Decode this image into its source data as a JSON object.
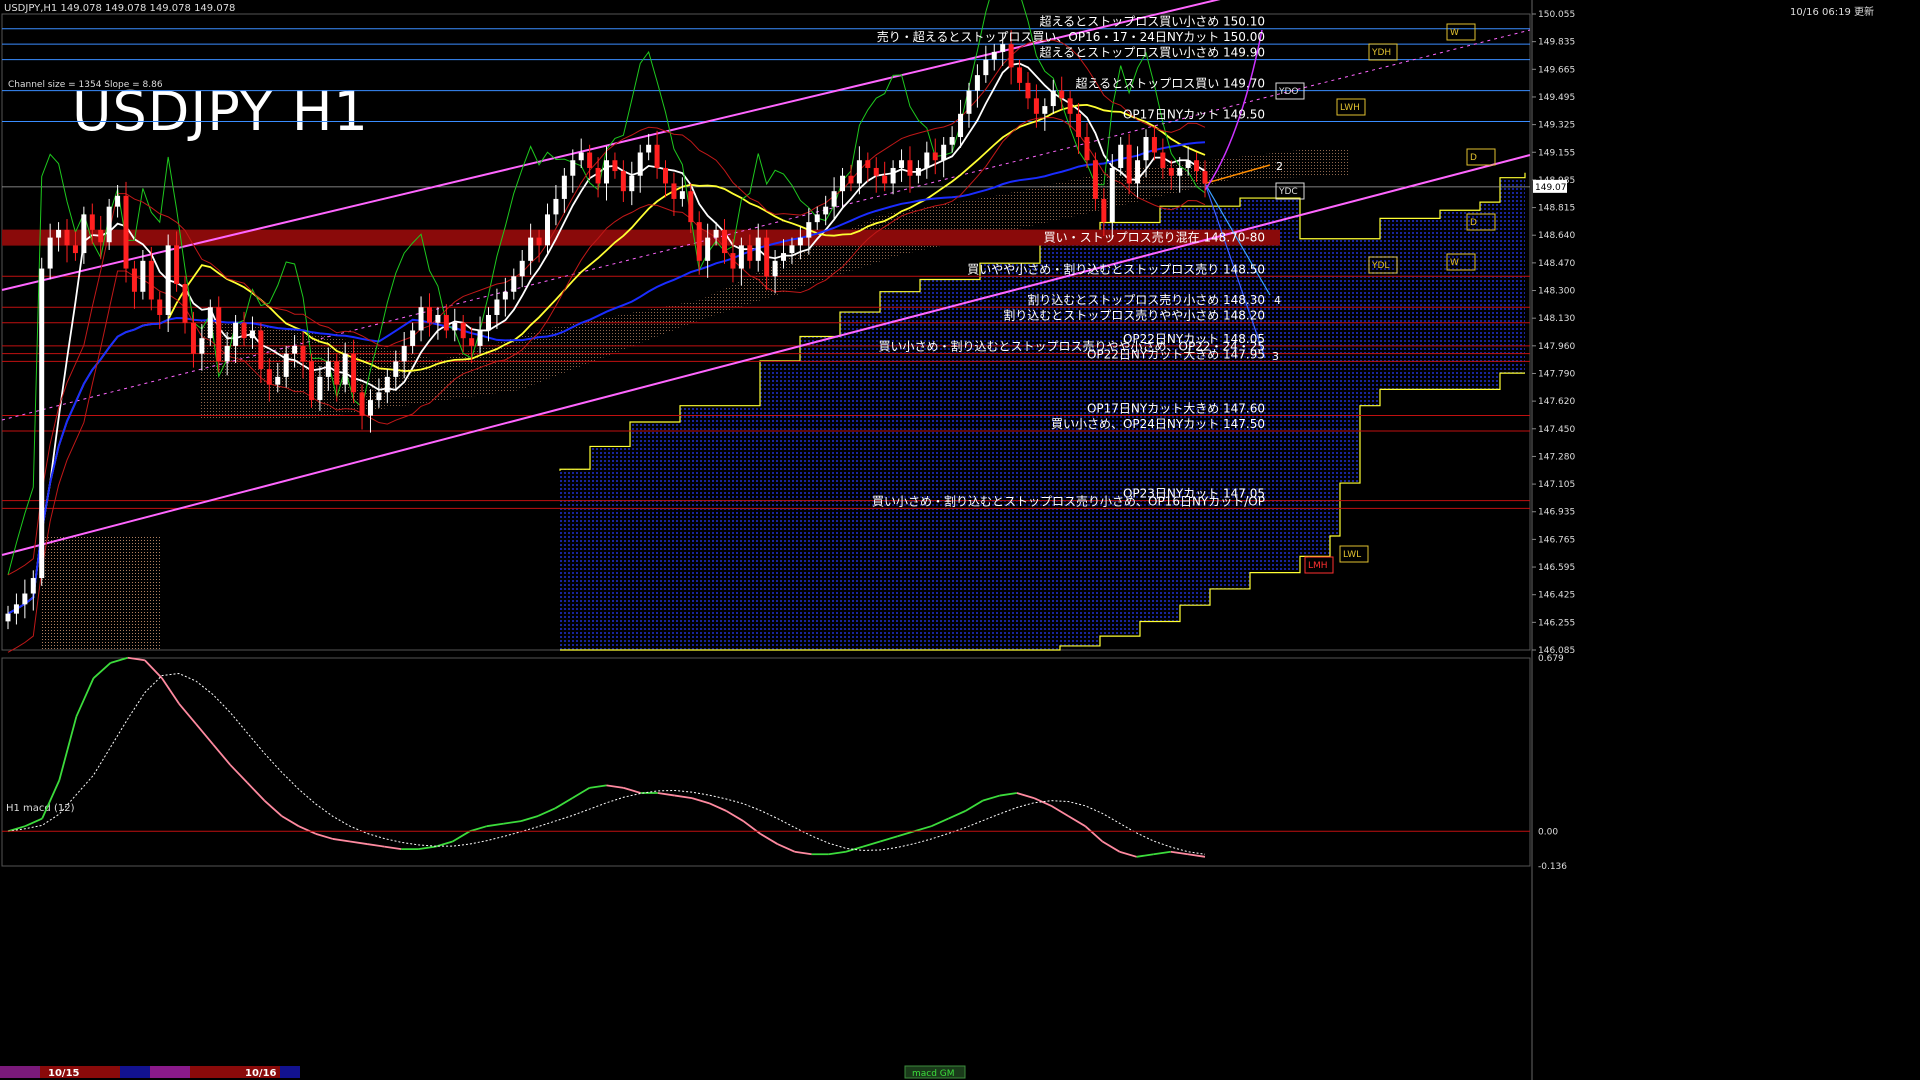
{
  "header": {
    "symbol_line": "USDJPY,H1  149.078 149.078 149.078 149.078",
    "title": "USDJPY H1",
    "channel_info": "Channel size = 1354  Slope = 8.86",
    "clock": "10/16 06:19 更新",
    "macd_label": "H1 macd (12)",
    "macd_mini_label": "macd GM"
  },
  "colors": {
    "background": "#000000",
    "up_candle": "#ffffff",
    "down_candle": "#ff2020",
    "channel": "#ff66ff",
    "ma_short": "#ffffff",
    "ma_mid": "#ffff33",
    "ma_long": "#1a2cff",
    "kumo_boundary": "#ffff33",
    "kumo_fill": "#101a66",
    "green_line": "#1ec81e",
    "macd_up": "#3cdc3c",
    "macd_down": "#ff8aa0",
    "hline_red": "#c01010",
    "hline_blue": "#3a8dff"
  },
  "chart_data": [
    {
      "type": "line",
      "title": "USDJPY H1",
      "ylim": [
        146.085,
        150.195
      ],
      "y_ticks": [
        "150.055",
        "149.835",
        "149.665",
        "149.495",
        "149.325",
        "149.155",
        "148.985",
        "148.815",
        "148.640",
        "148.470",
        "148.300",
        "148.130",
        "147.960",
        "147.790",
        "147.620",
        "147.450",
        "147.280",
        "147.105",
        "146.935",
        "146.765",
        "146.595",
        "146.425",
        "146.255",
        "146.085"
      ],
      "current_price": "149.078",
      "x_labels": [
        "10/15",
        "10/16"
      ],
      "annotations": [
        {
          "price": 150.1,
          "text": "超えるとストップロス買い小さめ 150.10",
          "color": "blue"
        },
        {
          "price": 150.0,
          "text": "売り・超えるとストップロス買い、OP16・17・24日NYカット 150.00",
          "color": "blue"
        },
        {
          "price": 149.9,
          "text": "超えるとストップロス買い小さめ 149.90",
          "color": "blue"
        },
        {
          "price": 149.7,
          "text": "超えるとストップロス買い 149.70",
          "color": "blue"
        },
        {
          "price": 149.5,
          "text": "OP17日NYカット 149.50",
          "color": "blue"
        },
        {
          "price": 148.75,
          "text": "買い・ストップロス売り混在 148.70-80",
          "color": "red-band"
        },
        {
          "price": 148.5,
          "text": "買いやや小さめ・割り込むとストップロス売り 148.50",
          "color": "red"
        },
        {
          "price": 148.3,
          "text": "割り込むとストップロス売り小さめ 148.30",
          "color": "red"
        },
        {
          "price": 148.2,
          "text": "割り込むとストップロス売りやや小さめ 148.20",
          "color": "red"
        },
        {
          "price": 148.05,
          "text": "OP22日NYカット 148.05",
          "color": "red"
        },
        {
          "price": 148.0,
          "text": "買い小さめ・割り込むとストップロス売りやや小さめ、OP22・24・25",
          "color": "red"
        },
        {
          "price": 147.95,
          "text": "OP22日NYカット大きめ 147.95",
          "color": "red"
        },
        {
          "price": 147.6,
          "text": "OP17日NYカット大きめ 147.60",
          "color": "red"
        },
        {
          "price": 147.5,
          "text": "買い小さめ、OP24日NYカット 147.50",
          "color": "red"
        },
        {
          "price": 147.05,
          "text": "OP23日NYカット 147.05",
          "color": "red"
        },
        {
          "price": 147.0,
          "text": "買い小さめ・割り込むとストップロス売り小さめ、OP16日NYカット/OP",
          "color": "red"
        }
      ],
      "box_labels": [
        "YDH",
        "YDO",
        "YDC",
        "YDL",
        "LWH",
        "LMH",
        "LWL",
        "D",
        "D",
        "W",
        "W"
      ],
      "wave_labels": [
        "2",
        "4",
        "3"
      ],
      "series_close": [
        146.32,
        146.38,
        146.45,
        146.55,
        148.55,
        148.75,
        148.8,
        148.7,
        148.65,
        148.9,
        148.8,
        148.72,
        148.95,
        149.02,
        148.55,
        148.4,
        148.6,
        148.35,
        148.25,
        148.7,
        148.45,
        148.2,
        148.0,
        148.1,
        148.3,
        147.95,
        148.05,
        148.2,
        148.1,
        148.15,
        147.9,
        147.8,
        147.85,
        148.0,
        148.05,
        147.95,
        147.7,
        147.85,
        147.95,
        147.8,
        148.0,
        147.75,
        147.6,
        147.7,
        147.75,
        147.85,
        147.95,
        148.05,
        148.15,
        148.3,
        148.2,
        148.25,
        148.15,
        148.2,
        148.1,
        148.05,
        148.15,
        148.25,
        148.35,
        148.4,
        148.5,
        148.6,
        148.75,
        148.7,
        148.9,
        149.0,
        149.15,
        149.25,
        149.3,
        149.2,
        149.1,
        149.25,
        149.18,
        149.05,
        149.15,
        149.3,
        149.35,
        149.2,
        149.1,
        149.0,
        149.05,
        148.85,
        148.6,
        148.75,
        148.8,
        148.65,
        148.55,
        148.7,
        148.6,
        148.75,
        148.5,
        148.6,
        148.65,
        148.7,
        148.75,
        148.85,
        148.9,
        148.95,
        149.05,
        149.15,
        149.1,
        149.25,
        149.2,
        149.15,
        149.1,
        149.2,
        149.25,
        149.15,
        149.2,
        149.3,
        149.25,
        149.35,
        149.4,
        149.55,
        149.7,
        149.8,
        149.9,
        149.95,
        150.0,
        149.85,
        149.75,
        149.65,
        149.55,
        149.6,
        149.7,
        149.65,
        149.55,
        149.4,
        149.25,
        149.0,
        148.85,
        149.2,
        149.35,
        149.1,
        149.25,
        149.4,
        149.3,
        149.2,
        149.15,
        149.2,
        149.25,
        149.18,
        149.1
      ],
      "macd": [
        0.0,
        0.02,
        0.05,
        0.2,
        0.45,
        0.6,
        0.66,
        0.68,
        0.67,
        0.6,
        0.5,
        0.42,
        0.34,
        0.26,
        0.19,
        0.12,
        0.06,
        0.02,
        -0.01,
        -0.03,
        -0.04,
        -0.05,
        -0.06,
        -0.07,
        -0.07,
        -0.06,
        -0.04,
        0.0,
        0.02,
        0.03,
        0.04,
        0.06,
        0.09,
        0.13,
        0.17,
        0.18,
        0.17,
        0.15,
        0.15,
        0.14,
        0.13,
        0.11,
        0.08,
        0.04,
        -0.01,
        -0.05,
        -0.08,
        -0.09,
        -0.09,
        -0.08,
        -0.06,
        -0.04,
        -0.02,
        0.0,
        0.02,
        0.05,
        0.08,
        0.12,
        0.14,
        0.15,
        0.13,
        0.1,
        0.06,
        0.02,
        -0.04,
        -0.08,
        -0.1,
        -0.09,
        -0.08,
        -0.09,
        -0.1
      ],
      "macd_ylim": [
        -0.136,
        0.679
      ]
    }
  ]
}
